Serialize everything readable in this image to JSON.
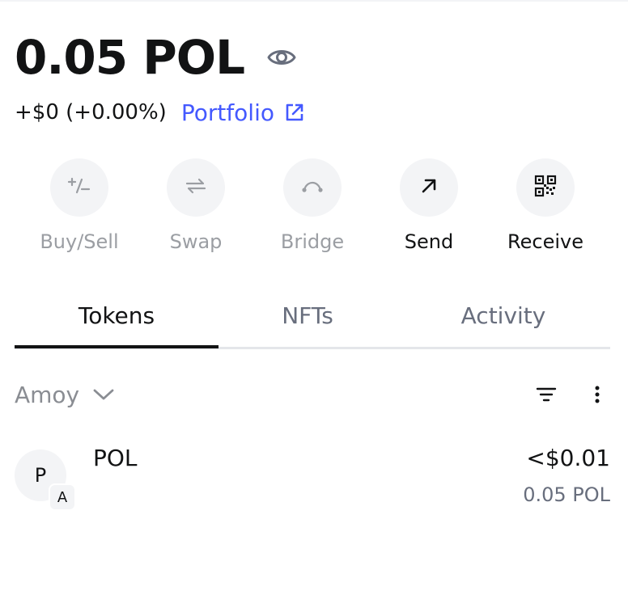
{
  "balance": {
    "amount": "0.05 POL",
    "change": "+$0 (+0.00%)",
    "portfolio_label": "Portfolio"
  },
  "actions": [
    {
      "label": "Buy/Sell",
      "icon": "plus-minus-icon",
      "enabled": false
    },
    {
      "label": "Swap",
      "icon": "swap-arrows-icon",
      "enabled": false
    },
    {
      "label": "Bridge",
      "icon": "bridge-icon",
      "enabled": false
    },
    {
      "label": "Send",
      "icon": "arrow-up-right-icon",
      "enabled": true
    },
    {
      "label": "Receive",
      "icon": "qr-code-icon",
      "enabled": true
    }
  ],
  "tabs": [
    {
      "label": "Tokens",
      "active": true
    },
    {
      "label": "NFTs",
      "active": false
    },
    {
      "label": "Activity",
      "active": false
    }
  ],
  "network_filter": {
    "label": "Amoy"
  },
  "tokens": [
    {
      "avatar_letter": "P",
      "network_badge": "A",
      "name": "POL",
      "fiat_value": "<$0.01",
      "balance": "0.05 POL"
    }
  ],
  "colors": {
    "accent": "#4459ff",
    "text_primary": "#121314",
    "text_muted": "#686e7d",
    "text_disabled": "#9b9ea3",
    "surface": "#f3f4f6"
  }
}
